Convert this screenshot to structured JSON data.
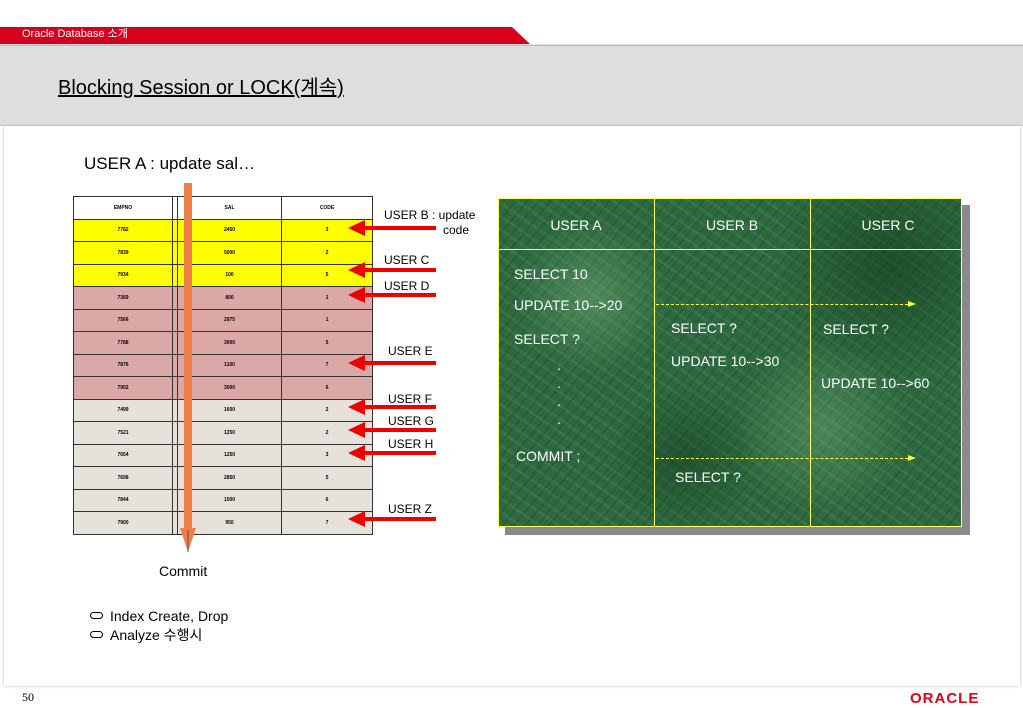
{
  "header": {
    "label": "Oracle Database 소개",
    "accent_color": "#d6001c"
  },
  "title": "Blocking Session or LOCK(계속)",
  "intro": "USER A : update sal…",
  "table": {
    "columns": [
      "EMPNO",
      "SAL",
      "CODE"
    ],
    "rows": [
      {
        "empno": "7782",
        "sal": "2450",
        "code": "3",
        "color": "yellow"
      },
      {
        "empno": "7839",
        "sal": "5000",
        "code": "2",
        "color": "yellow"
      },
      {
        "empno": "7934",
        "sal": "100",
        "code": "5",
        "color": "yellow"
      },
      {
        "empno": "7369",
        "sal": "800",
        "code": "1",
        "color": "pink"
      },
      {
        "empno": "7566",
        "sal": "2975",
        "code": "1",
        "color": "pink"
      },
      {
        "empno": "7788",
        "sal": "3000",
        "code": "5",
        "color": "pink"
      },
      {
        "empno": "7876",
        "sal": "1100",
        "code": "7",
        "color": "pink"
      },
      {
        "empno": "7902",
        "sal": "3000",
        "code": "6",
        "color": "pink"
      },
      {
        "empno": "7499",
        "sal": "1600",
        "code": "2",
        "color": "grey"
      },
      {
        "empno": "7521",
        "sal": "1250",
        "code": "2",
        "color": "grey"
      },
      {
        "empno": "7654",
        "sal": "1250",
        "code": "3",
        "color": "grey"
      },
      {
        "empno": "7698",
        "sal": "2850",
        "code": "5",
        "color": "grey"
      },
      {
        "empno": "7844",
        "sal": "1500",
        "code": "6",
        "color": "grey"
      },
      {
        "empno": "7900",
        "sal": "950",
        "code": "7",
        "color": "grey"
      }
    ]
  },
  "user_labels": {
    "b_line1": "USER B : update",
    "b_line2": "code",
    "c": "USER C",
    "d": "USER D",
    "e": "USER E",
    "f": "USER F",
    "g": "USER G",
    "h": "USER H",
    "z": "USER Z"
  },
  "commit_label": "Commit",
  "notes": [
    "Index Create, Drop",
    "Analyze 수행시"
  ],
  "panel": {
    "headers": [
      "USER A",
      "USER B",
      "USER C"
    ],
    "user_a": [
      "SELECT 10",
      "UPDATE 10-->20",
      "SELECT   ?",
      ".",
      ".",
      ".",
      ".",
      "COMMIT ;"
    ],
    "user_b": [
      "SELECT    ?",
      "UPDATE 10-->30",
      "SELECT   ?"
    ],
    "user_c": [
      "SELECT    ?",
      "UPDATE 10-->60"
    ]
  },
  "footer": {
    "page_number": "50",
    "logo": "ORACLE"
  },
  "colors": {
    "yellow": "#ffff00",
    "pink": "#dba7a7",
    "grey": "#e6e1da",
    "arrow_red": "#ee0000",
    "timeline_orange": "#f0804a",
    "panel_green": "#2c6a3e"
  }
}
